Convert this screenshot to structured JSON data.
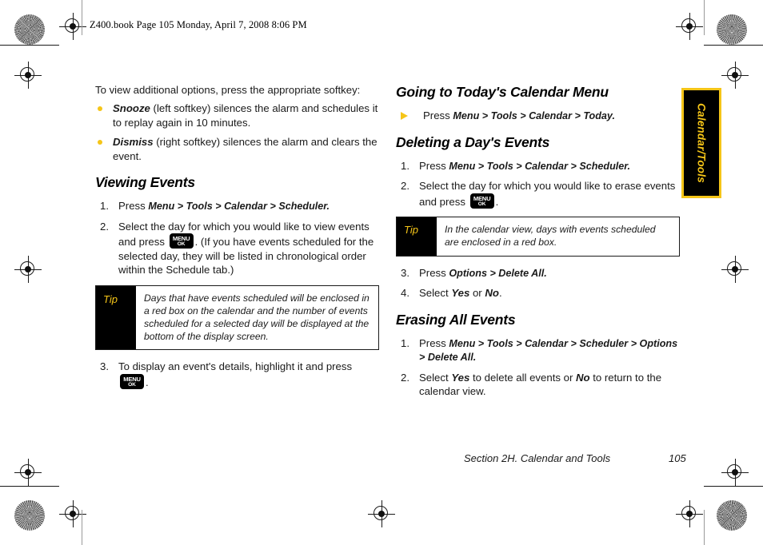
{
  "page": {
    "file_header": "Z400.book  Page 105  Monday, April 7, 2008  8:06 PM",
    "footer_section": "Section 2H. Calendar and Tools",
    "footer_page_number": "105",
    "side_tab_label": "Calendar/Tools",
    "accent_yellow": "#f5c518",
    "text_color": "#1a1a1a"
  },
  "key_glyph": {
    "top": "MENU",
    "bottom": "OK"
  },
  "left_column": {
    "intro": "To view additional options, press the appropriate softkey:",
    "softkey_bullets": [
      {
        "term": "Snooze",
        "rest": " (left softkey) silences the alarm and schedules it to replay again in 10 minutes."
      },
      {
        "term": "Dismiss",
        "rest": " (right softkey) silences the alarm and clears the event."
      }
    ],
    "heading": "Viewing Events",
    "steps": [
      {
        "lead": "Press ",
        "path": "Menu > Tools > Calendar > Scheduler.",
        "tail": ""
      },
      {
        "lead": "Select the day for which you would like to view events and press ",
        "key": true,
        "tail": ". (If you have events scheduled for the selected day, they will be listed in chronological order within the Schedule tab.)"
      },
      {
        "lead": "To display an event's details, highlight it and press ",
        "key": true,
        "tail": "."
      }
    ],
    "tip": {
      "label": "Tip",
      "body": "Days that have events scheduled will be enclosed in a red box on the calendar and the number of events scheduled for a selected day will be displayed at the bottom of the display screen."
    }
  },
  "right_column": {
    "heading_today": "Going to Today's Calendar Menu",
    "today_arrow_item": {
      "lead": "Press ",
      "path": "Menu > Tools > Calendar > Today."
    },
    "heading_deleting": "Deleting a Day's Events",
    "deleting_steps": [
      {
        "lead": "Press ",
        "path": "Menu > Tools > Calendar > Scheduler.",
        "tail": ""
      },
      {
        "lead": "Select the day for which you would like to erase events and press ",
        "key": true,
        "tail": "."
      },
      {
        "lead": "Press ",
        "path": "Options > Delete All.",
        "tail": ""
      },
      {
        "lead": "Select ",
        "em1": "Yes",
        "mid": " or ",
        "em2": "No",
        "tail": "."
      }
    ],
    "tip": {
      "label": "Tip",
      "body": "In the calendar view, days with events scheduled are enclosed in a red box."
    },
    "heading_erasing": "Erasing All Events",
    "erasing_steps": [
      {
        "lead": "Press ",
        "path": "Menu > Tools > Calendar > Scheduler > Options > Delete All.",
        "tail": ""
      },
      {
        "lead": "Select ",
        "em1": "Yes",
        "mid": " to delete all events or ",
        "em2": "No",
        "tail": " to return to the calendar view."
      }
    ]
  }
}
